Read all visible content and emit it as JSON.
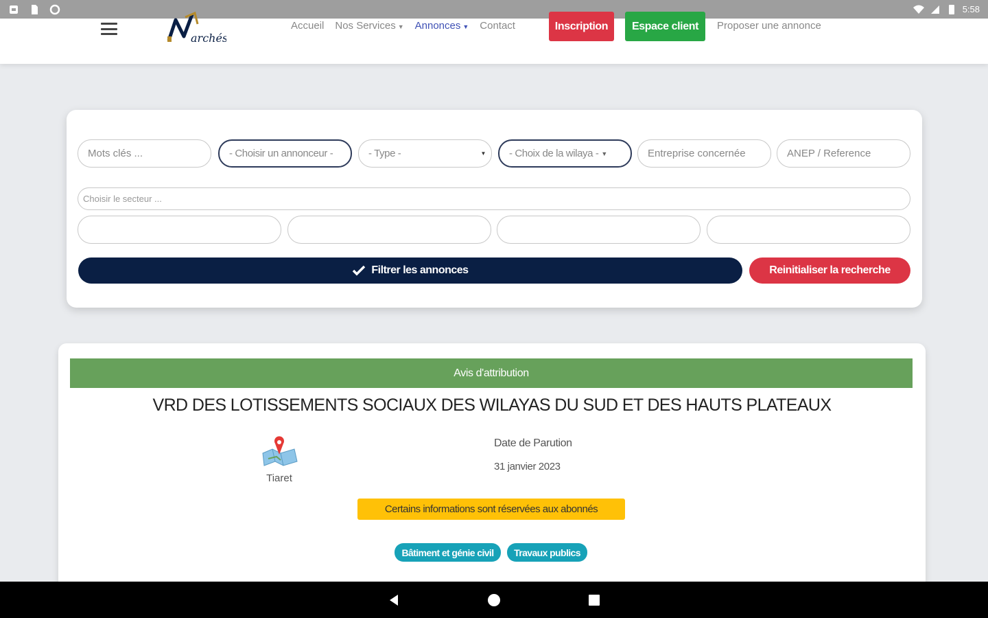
{
  "status_bar": {
    "time": "5:58"
  },
  "nav": {
    "links": [
      {
        "label": "Accueil",
        "dropdown": false,
        "active": false
      },
      {
        "label": "Nos Services",
        "dropdown": true,
        "active": false
      },
      {
        "label": "Annonces",
        "dropdown": true,
        "active": true
      },
      {
        "label": "Contact",
        "dropdown": false,
        "active": false
      }
    ],
    "inscription_label": "Inscription",
    "espace_client_label": "Espace client",
    "propose_label": "Proposer une annonce",
    "logo_alt": "Marchés"
  },
  "filters": {
    "keywords_placeholder": "Mots clés ...",
    "annonceur_label": "- Choisir un annonceur -",
    "type_label": "- Type -",
    "wilaya_label": "- Choix de la wilaya -",
    "entreprise_placeholder": "Entreprise concernée",
    "anep_placeholder": "ANEP / Reference",
    "sector_placeholder": "Choisir le secteur ...",
    "filter_button_label": "Filtrer les annonces",
    "reset_button_label": "Reinitialiser la recherche"
  },
  "announcement": {
    "category_label": "Avis d'attribution",
    "title": "VRD DES LOTISSEMENTS SOCIAUX DES WILAYAS DU SUD ET DES HAUTS PLATEAUX",
    "location": "Tiaret",
    "date_label": "Date de Parution",
    "date_value": "31 janvier 2023",
    "notice": "Certains informations sont réservées aux abonnés",
    "tags": [
      "Bâtiment et génie civil",
      "Travaux publics"
    ]
  },
  "colors": {
    "red": "#dc3545",
    "green": "#28a745",
    "navy": "#0a1f44",
    "attribution_green": "#67a15b",
    "notice_yellow": "#ffc107",
    "tag_teal": "#17a2b8"
  }
}
